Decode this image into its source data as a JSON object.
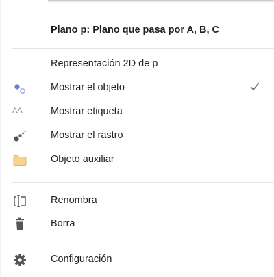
{
  "menu": {
    "title": "Plano p: Plano que pasa por A, B, C",
    "items": [
      {
        "label": "Representación 2D de p",
        "icon": "none"
      },
      {
        "label": "Mostrar el objeto",
        "icon": "show-object-icon",
        "checked": true
      },
      {
        "label": "Mostrar etiqueta",
        "icon": "label-icon",
        "icon_text": "AA"
      },
      {
        "label": "Mostrar el rastro",
        "icon": "trace-icon"
      },
      {
        "label": "Objeto auxiliar",
        "icon": "folder-icon"
      },
      {
        "label": "Renombra",
        "icon": "rename-icon"
      },
      {
        "label": "Borra",
        "icon": "trash-icon"
      },
      {
        "label": "Configuración",
        "icon": "gear-icon"
      }
    ]
  },
  "colors": {
    "accent_blue": "#6f7bd6",
    "folder_yellow": "#f6d58b",
    "icon_gray": "#555555",
    "divider": "#e4e4e4"
  }
}
